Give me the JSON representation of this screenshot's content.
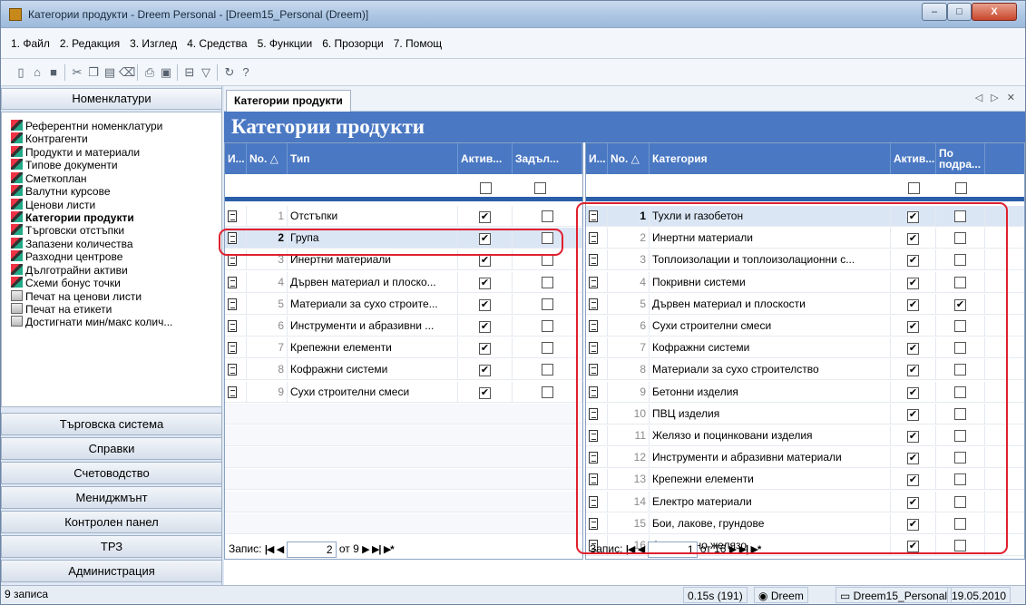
{
  "window": {
    "title": "Категории продукти - Dreem Personal - [Dreem15_Personal (Dreem)]",
    "close": "X",
    "min": "–",
    "max": "□"
  },
  "menu": [
    "1. Файл",
    "2. Редакция",
    "3. Изглед",
    "4. Средства",
    "5. Функции",
    "6. Прозорци",
    "7. Помощ"
  ],
  "sidebar": {
    "header": "Номенклатури",
    "items": [
      {
        "label": "Референтни номенклатури",
        "icon": "table-icon"
      },
      {
        "label": "Контрагенти",
        "icon": "table-icon"
      },
      {
        "label": "Продукти и материали",
        "icon": "table-icon"
      },
      {
        "label": "Типове документи",
        "icon": "table-icon"
      },
      {
        "label": "Сметкоплан",
        "icon": "table-icon"
      },
      {
        "label": "Валутни курсове",
        "icon": "table-icon"
      },
      {
        "label": "Ценови листи",
        "icon": "table-icon"
      },
      {
        "label": "Категории продукти",
        "icon": "table-icon",
        "selected": true
      },
      {
        "label": "Търговски отстъпки",
        "icon": "table-icon"
      },
      {
        "label": "Запазени количества",
        "icon": "table-icon"
      },
      {
        "label": "Разходни центрове",
        "icon": "table-icon"
      },
      {
        "label": "Дълготрайни активи",
        "icon": "table-icon"
      },
      {
        "label": "Схеми бонус точки",
        "icon": "table-icon"
      },
      {
        "label": "Печат на ценови листи",
        "icon": "print-icon"
      },
      {
        "label": "Печат на етикети",
        "icon": "print-icon"
      },
      {
        "label": "Достигнати мин/макс колич...",
        "icon": "print-icon"
      }
    ],
    "groups": [
      "Търговска система",
      "Справки",
      "Счетоводство",
      "Мениджмънт",
      "Контролен панел",
      "ТРЗ",
      "Администрация"
    ]
  },
  "tab": {
    "label": "Категории продукти",
    "nav": "◁ ▷ ✕"
  },
  "page_title": "Категории продукти",
  "left_grid": {
    "columns": [
      "И...",
      "No. △",
      "Тип",
      "Актив...",
      "Задъл..."
    ],
    "rows": [
      {
        "no": "1",
        "name": "Отстъпки",
        "active": true,
        "required": false
      },
      {
        "no": "2",
        "name": "Група",
        "active": true,
        "required": false,
        "current": true
      },
      {
        "no": "3",
        "name": "Инертни материали",
        "active": true,
        "required": false
      },
      {
        "no": "4",
        "name": "Дървен материал и плоско...",
        "active": true,
        "required": false
      },
      {
        "no": "5",
        "name": "Материали за сухо строите...",
        "active": true,
        "required": false
      },
      {
        "no": "6",
        "name": "Инструменти и абразивни ...",
        "active": true,
        "required": false
      },
      {
        "no": "7",
        "name": "Крепежни елементи",
        "active": true,
        "required": false
      },
      {
        "no": "8",
        "name": "Кофражни системи",
        "active": true,
        "required": false
      },
      {
        "no": "9",
        "name": "Сухи строителни смеси",
        "active": true,
        "required": false
      }
    ],
    "pager": {
      "label": "Запис:",
      "current": "2",
      "total": "от 9"
    }
  },
  "right_grid": {
    "columns": [
      "И...",
      "No. △",
      "Категория",
      "Актив...",
      "По подра..."
    ],
    "rows": [
      {
        "no": "1",
        "name": "Тухли и газобетон",
        "active": true,
        "default": false,
        "current": true
      },
      {
        "no": "2",
        "name": "Инертни материали",
        "active": true,
        "default": false
      },
      {
        "no": "3",
        "name": "Топлоизолации и топлоизолационни с...",
        "active": true,
        "default": false
      },
      {
        "no": "4",
        "name": "Покривни системи",
        "active": true,
        "default": false
      },
      {
        "no": "5",
        "name": "Дървен материал и плоскости",
        "active": true,
        "default": true
      },
      {
        "no": "6",
        "name": "Сухи строителни смеси",
        "active": true,
        "default": false
      },
      {
        "no": "7",
        "name": "Кофражни системи",
        "active": true,
        "default": false
      },
      {
        "no": "8",
        "name": "Материали за сухо строителство",
        "active": true,
        "default": false
      },
      {
        "no": "9",
        "name": "Бетонни изделия",
        "active": true,
        "default": false
      },
      {
        "no": "10",
        "name": "ПВЦ изделия",
        "active": true,
        "default": false
      },
      {
        "no": "11",
        "name": "Желязо и поцинковани изделия",
        "active": true,
        "default": false
      },
      {
        "no": "12",
        "name": "Инструменти и абразивни материали",
        "active": true,
        "default": false
      },
      {
        "no": "13",
        "name": "Крепежни елементи",
        "active": true,
        "default": false
      },
      {
        "no": "14",
        "name": "Електро материали",
        "active": true,
        "default": false
      },
      {
        "no": "15",
        "name": "Бои, лакове, грундове",
        "active": true,
        "default": false
      },
      {
        "no": "16",
        "name": "Арматурно желязо",
        "active": true,
        "default": false
      }
    ],
    "pager": {
      "label": "Запис:",
      "current": "1",
      "total": "от 16"
    }
  },
  "status": {
    "records": "9 записа",
    "timing": "0.15s (191)",
    "user": "Dreem",
    "db": "Dreem15_Personal",
    "date": "19.05.2010"
  },
  "colors": {
    "accent": "#4a78c3",
    "highlight": "#e0202e"
  }
}
